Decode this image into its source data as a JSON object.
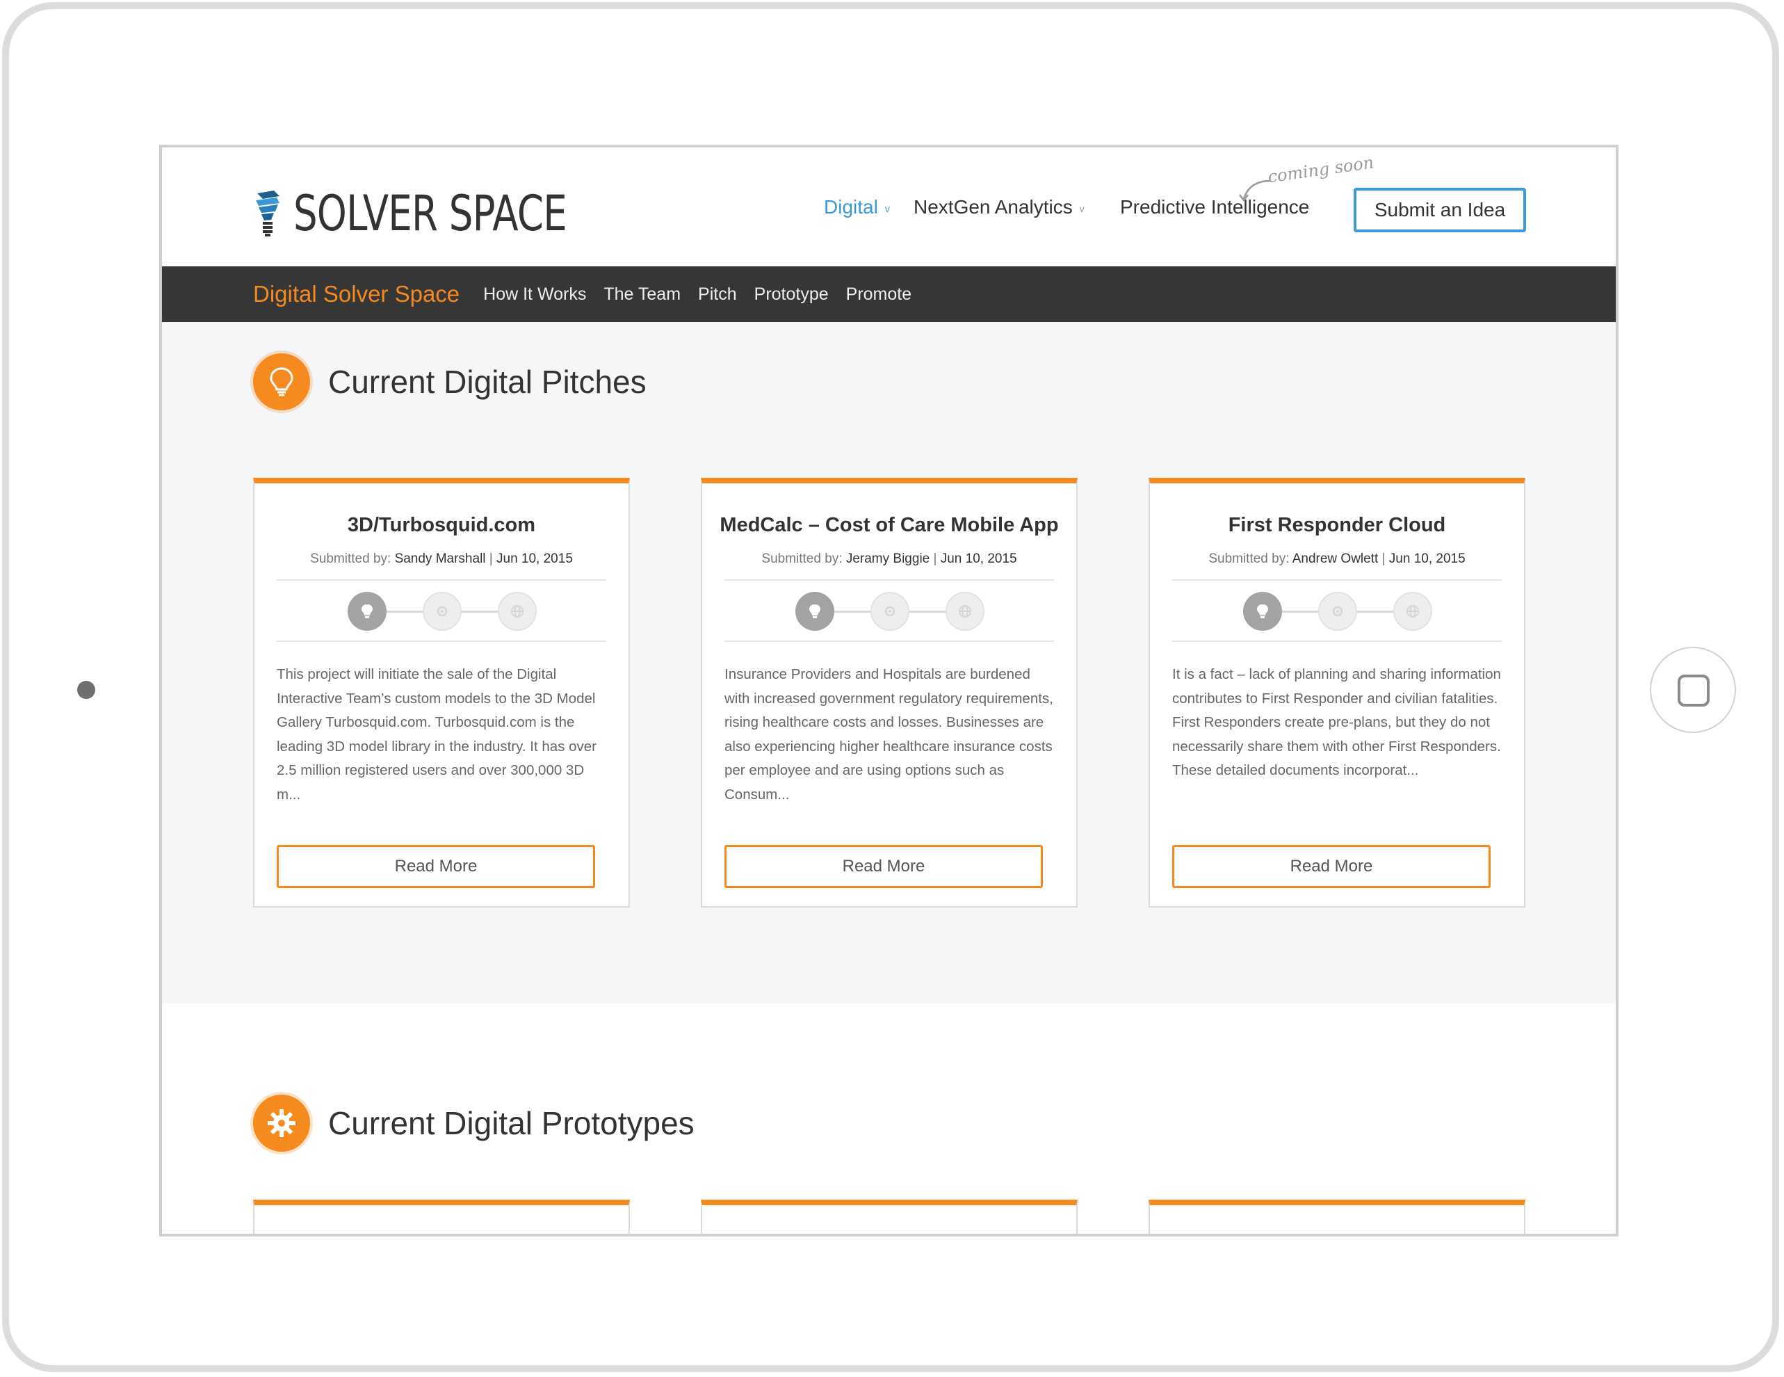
{
  "brand": {
    "logo_text": "SOLVER SPACE",
    "logo_icon": "lightbulb-logo-icon",
    "colors": {
      "accent_orange": "#f58a1f",
      "accent_blue": "#3a9ad9",
      "dark_bar": "#363636"
    }
  },
  "topnav": {
    "items": [
      {
        "label": "Digital",
        "active": true,
        "dropdown": true
      },
      {
        "label": "NextGen Analytics",
        "active": false,
        "dropdown": true
      },
      {
        "label": "Predictive Intelligence",
        "active": false,
        "dropdown": false
      }
    ],
    "chevron": "v",
    "coming_soon_note": "coming soon",
    "submit_label": "Submit an Idea"
  },
  "subnav": {
    "brand": "Digital Solver Space",
    "links": [
      "How It Works",
      "The Team",
      "Pitch",
      "Prototype",
      "Promote"
    ]
  },
  "pitches": {
    "title": "Current Digital Pitches",
    "icon": "lightbulb-icon",
    "submitted_prefix": "Submitted by:",
    "separator": "|",
    "read_more_label": "Read More",
    "cards": [
      {
        "title": "3D/Turbosquid.com",
        "author": "Sandy Marshall",
        "date": "Jun 10, 2015",
        "stage": 1,
        "excerpt": "This project will initiate the sale of the Digital Interactive Team’s custom models to the 3D Model Gallery Turbosquid.com. Turbosquid.com is the leading 3D model library in the industry. It has over 2.5 million registered users and over 300,000 3D m..."
      },
      {
        "title": "MedCalc – Cost of Care Mobile App",
        "author": "Jeramy Biggie",
        "date": "Jun 10, 2015",
        "stage": 1,
        "excerpt": "Insurance Providers and Hospitals are burdened with increased government regulatory requirements, rising healthcare costs and losses. Businesses are also experiencing higher healthcare insurance costs per employee and are using options such as Consum..."
      },
      {
        "title": "First Responder Cloud",
        "author": "Andrew Owlett",
        "date": "Jun 10, 2015",
        "stage": 1,
        "excerpt": "It is a fact – lack of planning and sharing information contributes to First Responder and civilian fatalities. First Responders create pre-plans, but they do not necessarily share them with other First Responders. These detailed documents incorporat..."
      }
    ],
    "stage_icons": [
      "lightbulb-stage-icon",
      "gear-stage-icon",
      "globe-stage-icon"
    ]
  },
  "prototypes": {
    "title": "Current Digital Prototypes",
    "icon": "gear-icon"
  }
}
